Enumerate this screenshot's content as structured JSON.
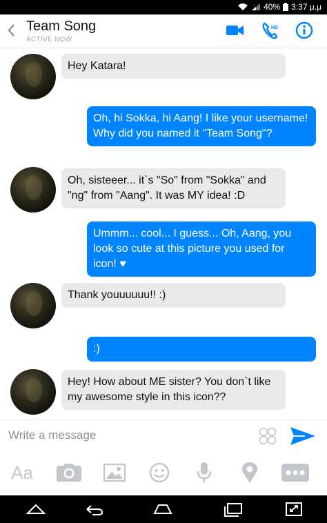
{
  "status": {
    "battery": "40%",
    "time": "3:37 μ.μ"
  },
  "header": {
    "title": "Team Song",
    "subtitle": "ACTIVE NOW"
  },
  "messages": [
    {
      "from": "them",
      "text": "Hey Katara!"
    },
    {
      "from": "me",
      "text": "Oh, hi Sokka, hi Aang! I like your username! Why did you named it \"Team Song\"?"
    },
    {
      "from": "them",
      "text": "Oh, sisteeer... it`s \"So\" from \"Sokka\" and \"ng\" from \"Aang\". It was MY idea! :D"
    },
    {
      "from": "me",
      "text": "Ummm... cool... I guess... Oh, Aang, you look so cute at this picture you used for icon! ♥"
    },
    {
      "from": "them",
      "text": "Thank youuuuuu!! :)"
    },
    {
      "from": "me",
      "text": ":)"
    },
    {
      "from": "them",
      "text": "Hey! How about ME sister? You don`t like my awesome style in this icon??"
    }
  ],
  "composer": {
    "placeholder": "Write a message"
  },
  "toolbar": {
    "text_label": "Aa"
  },
  "colors": {
    "accent": "#0084ff",
    "incoming_bubble": "#e9e9eb",
    "outgoing_bubble": "#0084ff",
    "toolbar_icon": "#c3c7cc"
  },
  "icons": [
    "back-icon",
    "video-call-icon",
    "hd-phone-call-icon",
    "info-icon",
    "stickers-icon",
    "send-icon",
    "camera-icon",
    "gallery-icon",
    "emoji-icon",
    "microphone-icon",
    "location-icon",
    "more-icon"
  ]
}
